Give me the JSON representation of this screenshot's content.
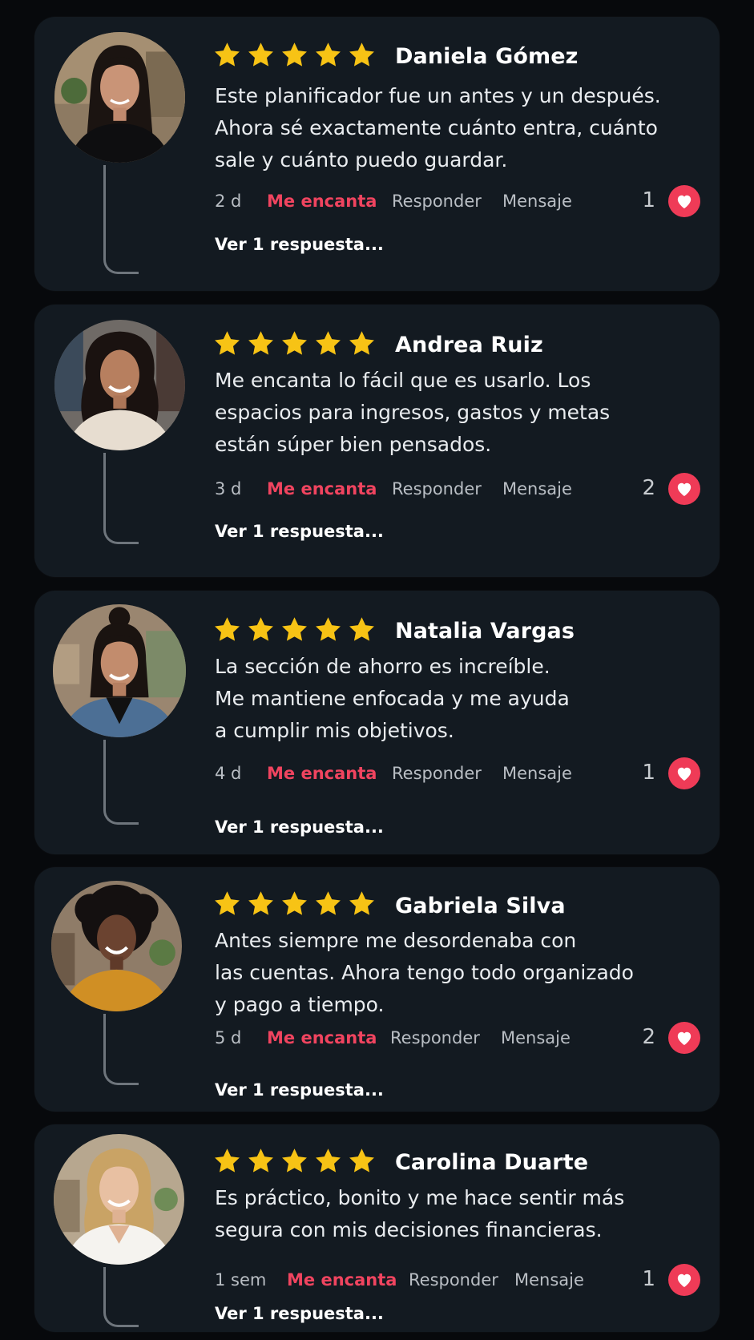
{
  "colors": {
    "page_background": "#07090c",
    "card_background": "#131a21",
    "star": "#f7c315",
    "accent_love": "#f0445f",
    "heart_badge": "#ef3b57",
    "muted_text": "#b9bec4"
  },
  "reviews": [
    {
      "name": "Daniela Gómez",
      "rating": 5,
      "comment_lines": [
        "Este planificador fue un antes y un después.",
        "Ahora sé exactamente cuánto entra, cuánto",
        "sale y cuánto puedo guardar."
      ],
      "time": "2 d",
      "love_label": "Me encanta",
      "reply_label": "Responder",
      "message_label": "Mensaje",
      "like_count": "1",
      "replies_link": "Ver 1 respuesta..."
    },
    {
      "name": "Andrea Ruiz",
      "rating": 5,
      "comment_lines": [
        "Me encanta lo fácil que es usarlo. Los",
        "espacios para ingresos, gastos y metas",
        "están súper bien pensados."
      ],
      "time": "3 d",
      "love_label": "Me encanta",
      "reply_label": "Responder",
      "message_label": "Mensaje",
      "like_count": "2",
      "replies_link": "Ver 1 respuesta..."
    },
    {
      "name": "Natalia Vargas",
      "rating": 5,
      "comment_lines": [
        "La sección de ahorro es increíble.",
        "Me mantiene enfocada y me ayuda",
        "a cumplir mis objetivos."
      ],
      "time": "4 d",
      "love_label": "Me encanta",
      "reply_label": "Responder",
      "message_label": "Mensaje",
      "like_count": "1",
      "replies_link": "Ver 1 respuesta..."
    },
    {
      "name": "Gabriela Silva",
      "rating": 5,
      "comment_lines": [
        "Antes siempre me desordenaba con",
        "las cuentas. Ahora tengo todo organizado",
        "y pago a tiempo."
      ],
      "time": "5 d",
      "love_label": "Me encanta",
      "reply_label": "Responder",
      "message_label": "Mensaje",
      "like_count": "2",
      "replies_link": "Ver 1 respuesta..."
    },
    {
      "name": "Carolina Duarte",
      "rating": 5,
      "comment_lines": [
        "Es práctico, bonito y me hace sentir más",
        "segura con mis decisiones financieras."
      ],
      "time": "1 sem",
      "love_label": "Me encanta",
      "reply_label": "Responder",
      "message_label": "Mensaje",
      "like_count": "1",
      "replies_link": "Ver 1 respuesta..."
    }
  ]
}
